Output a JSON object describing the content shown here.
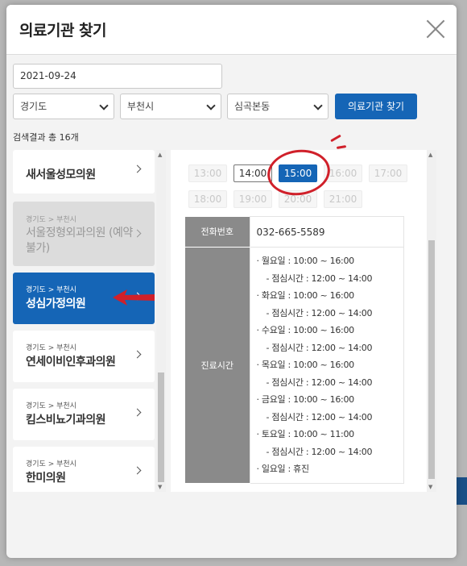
{
  "modal": {
    "title": "의료기관 찾기"
  },
  "search": {
    "date": "2021-09-24",
    "province": "경기도",
    "city": "부천시",
    "district": "심곡본동",
    "button_label": "의료기관 찾기"
  },
  "results": {
    "count_label": "검색결과 총 16개",
    "items": [
      {
        "region": "",
        "name": "새서울성모의원",
        "state": "normal"
      },
      {
        "region": "경기도 > 부천시",
        "name_line1": "서울정형외과의원 (예약",
        "name_line2": "불가)",
        "state": "disabled"
      },
      {
        "region": "경기도 > 부천시",
        "name": "성심가정의원",
        "state": "selected"
      },
      {
        "region": "경기도 > 부천시",
        "name": "연세이비인후과의원",
        "state": "normal"
      },
      {
        "region": "경기도 > 부천시",
        "name": "킴스비뇨기과의원",
        "state": "normal"
      },
      {
        "region": "경기도 > 부천시",
        "name": "한미의원",
        "state": "normal"
      }
    ],
    "first_item_region": "경기도 > 부천시"
  },
  "times": [
    {
      "label": "13:00",
      "state": "unavailable"
    },
    {
      "label": "14:00",
      "state": "available"
    },
    {
      "label": "15:00",
      "state": "selected"
    },
    {
      "label": "16:00",
      "state": "unavailable"
    },
    {
      "label": "17:00",
      "state": "unavailable"
    },
    {
      "label": "18:00",
      "state": "unavailable"
    },
    {
      "label": "19:00",
      "state": "unavailable"
    },
    {
      "label": "20:00",
      "state": "unavailable"
    },
    {
      "label": "21:00",
      "state": "unavailable"
    }
  ],
  "detail": {
    "phone_label": "전화번호",
    "phone": "032-665-5589",
    "hours_label": "진료시간",
    "schedule": [
      "· 월요일 : 10:00 ~ 16:00",
      "- 점심시간 : 12:00 ~ 14:00",
      "· 화요일 : 10:00 ~ 16:00",
      "- 점심시간 : 12:00 ~ 14:00",
      "· 수요일 : 10:00 ~ 16:00",
      "- 점심시간 : 12:00 ~ 14:00",
      "· 목요일 : 10:00 ~ 16:00",
      "- 점심시간 : 12:00 ~ 14:00",
      "· 금요일 : 10:00 ~ 16:00",
      "- 점심시간 : 12:00 ~ 14:00",
      "· 토요일 : 10:00 ~ 11:00",
      "- 점심시간 : 12:00 ~ 14:00",
      "· 일요일 : 휴진"
    ]
  },
  "colors": {
    "accent": "#1565b6",
    "annotation_red": "#d0202a",
    "header_cell": "#8a8a8a"
  },
  "icons": {
    "close": "close-icon",
    "dropdown": "chevron-down-icon",
    "list_arrow": "chevron-right-icon",
    "annotation": "red-arrow-annotation"
  }
}
